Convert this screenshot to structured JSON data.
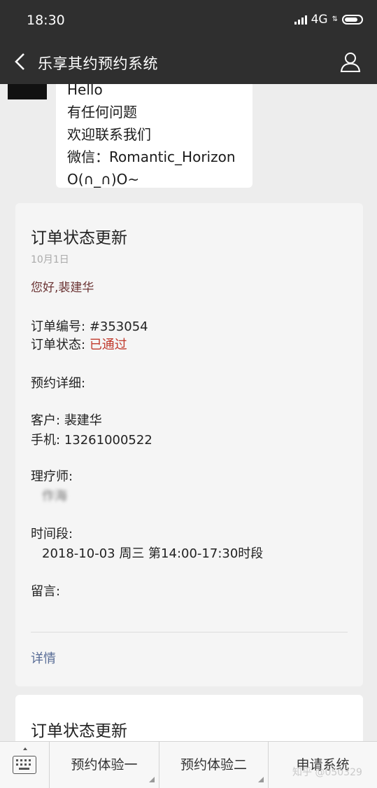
{
  "status_bar": {
    "time": "18:30",
    "network": "4G"
  },
  "nav": {
    "title": "乐享其约预约系统"
  },
  "message": {
    "lines": [
      "Hello",
      "有任何问题",
      "欢迎联系我们",
      "微信：Romantic_Horizon",
      "O(∩_∩)O~"
    ]
  },
  "card": {
    "title": "订单状态更新",
    "date": "10月1日",
    "greeting": "您好,裴建华",
    "order_no_label": "订单编号:",
    "order_no": "#353054",
    "status_label": "订单状态:",
    "status": "已通过",
    "details_label": "预约详细:",
    "customer_label": "客户:",
    "customer": "裴建华",
    "phone_label": "手机:",
    "phone": "13261000522",
    "therapist_label": "理疗师:",
    "therapist": "作海",
    "timeslot_label": "时间段:",
    "timeslot": "2018-10-03 周三 第14:00-17:30时段",
    "note_label": "留言:",
    "detail_link": "详情"
  },
  "card2": {
    "title": "订单状态更新"
  },
  "bottom_menu": {
    "items": [
      "预约体验一",
      "预约体验二",
      "申请系统"
    ]
  },
  "watermark": "知乎 @050329"
}
